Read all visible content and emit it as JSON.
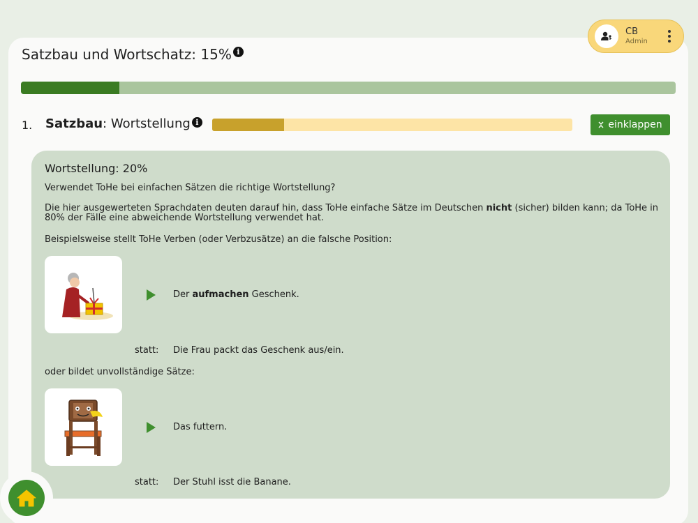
{
  "page": {
    "title": "Satzbau und Wortschatz: 15%",
    "progress": 0.15
  },
  "user": {
    "initials": "CB",
    "role": "Admin"
  },
  "section": {
    "number": "1.",
    "title_bold": "Satzbau",
    "title_rest": ": Wortstellung",
    "progress": 0.2,
    "collapse_label": "einklappen"
  },
  "panel": {
    "heading": "Wortstellung: 20%",
    "question": "Verwendet ToHe bei einfachen Sätzen die richtige Wortstellung?",
    "assessment_pre": "Die hier ausgewerteten Sprachdaten deuten darauf hin, dass ToHe einfache Sätze im Deutschen ",
    "assessment_bold": "nicht",
    "assessment_post": " (sicher) bilden kann; da ToHe in 80% der Fälle eine abweichende Wortstellung verwendet hat.",
    "intro1": "Beispielsweise stellt ToHe Verben (oder Verbzusätze) an die falsche Position:",
    "intro2": "oder bildet unvollständige Sätze:",
    "examples": [
      {
        "image": "woman-unwrapping-gift",
        "sentence_pre": "Der ",
        "sentence_bold": "aufmachen",
        "sentence_post": " Geschenk.",
        "statt_label": "statt:",
        "correct": "Die Frau packt das Geschenk aus/ein."
      },
      {
        "image": "chair-eating-banana",
        "sentence_pre": "Das futtern.",
        "sentence_bold": "",
        "sentence_post": "",
        "statt_label": "statt:",
        "correct": "Der Stuhl isst die Banane."
      }
    ]
  },
  "colors": {
    "accent_green": "#3f8f2e",
    "progress_dark": "#3a7b22",
    "progress_light": "#aac59e",
    "section_fill": "#c8a12c",
    "section_track": "#fde4a6",
    "panel_bg": "#cfdccb",
    "user_chip": "#f9d77a"
  }
}
